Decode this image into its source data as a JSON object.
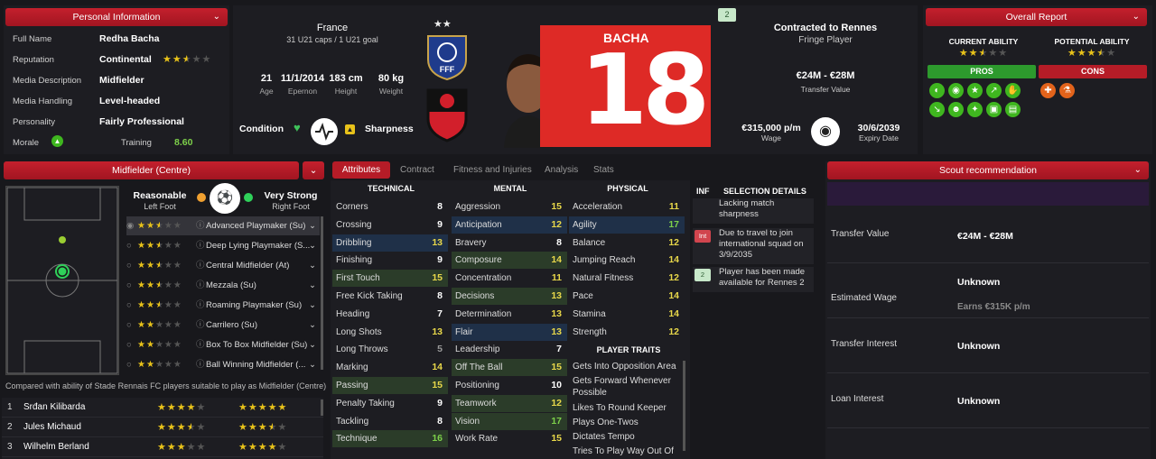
{
  "personal": {
    "header": "Personal Information",
    "rows": [
      {
        "label": "Full Name",
        "value": "Redha Bacha"
      },
      {
        "label": "Reputation",
        "value": "Continental"
      },
      {
        "label": "Media Description",
        "value": "Midfielder"
      },
      {
        "label": "Media Handling",
        "value": "Level-headed"
      },
      {
        "label": "Personality",
        "value": "Fairly Professional"
      }
    ],
    "reputation_stars": 2.5,
    "morale_label": "Morale",
    "training_label": "Training",
    "training_value": "8.60"
  },
  "bio": {
    "nation": "France",
    "caps": "31 U21 caps / 1 U21 goal",
    "age": "21",
    "age_label": "Age",
    "dob": "11/1/2014",
    "dob_label": "Epernon",
    "height": "183 cm",
    "height_label": "Height",
    "weight": "80 kg",
    "weight_label": "Weight",
    "condition_label": "Condition",
    "sharpness_label": "Sharpness"
  },
  "kit": {
    "name": "BACHA",
    "number": "18",
    "badge": "2"
  },
  "contract": {
    "title": "Contracted to Rennes",
    "status": "Fringe Player",
    "value": "€24M - €28M",
    "value_label": "Transfer Value",
    "wage": "€315,000 p/m",
    "wage_label": "Wage",
    "expiry": "30/6/2039",
    "expiry_label": "Expiry Date"
  },
  "overall": {
    "header": "Overall Report",
    "ca_label": "CURRENT ABILITY",
    "pa_label": "POTENTIAL ABILITY",
    "ca_stars": 2.5,
    "pa_stars": 3.5,
    "pros_label": "PROS",
    "cons_label": "CONS"
  },
  "position": {
    "header": "Midfielder (Centre)",
    "left_foot_level": "Reasonable",
    "left_foot": "Left Foot",
    "right_foot_level": "Very Strong",
    "right_foot": "Right Foot",
    "roles": [
      {
        "name": "Advanced Playmaker (Su)",
        "stars": 2.5
      },
      {
        "name": "Deep Lying Playmaker (S...",
        "stars": 2.5
      },
      {
        "name": "Central Midfielder (At)",
        "stars": 2.5
      },
      {
        "name": "Mezzala (Su)",
        "stars": 2.5
      },
      {
        "name": "Roaming Playmaker (Su)",
        "stars": 2.5
      },
      {
        "name": "Carrilero (Su)",
        "stars": 2
      },
      {
        "name": "Box To Box Midfielder (Su)",
        "stars": 2
      },
      {
        "name": "Ball Winning Midfielder (...",
        "stars": 2
      }
    ],
    "compare_text": "Compared with ability of Stade Rennais FC players suitable to play as Midfielder (Centre)",
    "compare": [
      {
        "rank": "1",
        "name": "Srđan Kilibarda",
        "ca": 4,
        "pa": 5
      },
      {
        "rank": "2",
        "name": "Jules Michaud",
        "ca": 3.5,
        "pa": 3.5
      },
      {
        "rank": "3",
        "name": "Wilhelm Berland",
        "ca": 3,
        "pa": 4
      }
    ]
  },
  "tabs": [
    "Attributes",
    "Contract",
    "Fitness and Injuries",
    "Analysis",
    "Stats"
  ],
  "attributes": {
    "technical_label": "TECHNICAL",
    "mental_label": "MENTAL",
    "physical_label": "PHYSICAL",
    "technical": [
      [
        "Corners",
        "8"
      ],
      [
        "Crossing",
        "9"
      ],
      [
        "Dribbling",
        "13"
      ],
      [
        "Finishing",
        "9"
      ],
      [
        "First Touch",
        "15"
      ],
      [
        "Free Kick Taking",
        "8"
      ],
      [
        "Heading",
        "7"
      ],
      [
        "Long Shots",
        "13"
      ],
      [
        "Long Throws",
        "5"
      ],
      [
        "Marking",
        "14"
      ],
      [
        "Passing",
        "15"
      ],
      [
        "Penalty Taking",
        "9"
      ],
      [
        "Tackling",
        "8"
      ],
      [
        "Technique",
        "16"
      ]
    ],
    "mental": [
      [
        "Aggression",
        "15"
      ],
      [
        "Anticipation",
        "12"
      ],
      [
        "Bravery",
        "8"
      ],
      [
        "Composure",
        "14"
      ],
      [
        "Concentration",
        "11"
      ],
      [
        "Decisions",
        "13"
      ],
      [
        "Determination",
        "13"
      ],
      [
        "Flair",
        "13"
      ],
      [
        "Leadership",
        "7"
      ],
      [
        "Off The Ball",
        "15"
      ],
      [
        "Positioning",
        "10"
      ],
      [
        "Teamwork",
        "12"
      ],
      [
        "Vision",
        "17"
      ],
      [
        "Work Rate",
        "15"
      ]
    ],
    "physical": [
      [
        "Acceleration",
        "11"
      ],
      [
        "Agility",
        "17"
      ],
      [
        "Balance",
        "12"
      ],
      [
        "Jumping Reach",
        "14"
      ],
      [
        "Natural Fitness",
        "12"
      ],
      [
        "Pace",
        "14"
      ],
      [
        "Stamina",
        "14"
      ],
      [
        "Strength",
        "12"
      ]
    ],
    "traits_label": "PLAYER TRAITS",
    "traits": [
      "Gets Into Opposition Area",
      "Gets Forward Whenever Possible",
      "Likes To Round Keeper",
      "Plays One-Twos",
      "Dictates Tempo",
      "Tries To Play Way Out Of ..."
    ]
  },
  "selection": {
    "inf_label": "INF",
    "header": "SELECTION DETAILS",
    "items": [
      {
        "badge": "",
        "text": "Lacking match sharpness"
      },
      {
        "badge": "Int",
        "text": "Due to travel to join international squad on 3/9/2035"
      },
      {
        "badge": "2",
        "text": "Player has been made available for Rennes 2"
      }
    ]
  },
  "scout": {
    "header": "Scout recommendation",
    "rows": [
      {
        "label": "Transfer Value",
        "value": "€24M - €28M",
        "sub": ""
      },
      {
        "label": "Estimated Wage",
        "value": "Unknown",
        "sub": "Earns €315K p/m"
      },
      {
        "label": "Transfer Interest",
        "value": "Unknown",
        "sub": ""
      },
      {
        "label": "Loan Interest",
        "value": "Unknown",
        "sub": ""
      }
    ]
  }
}
